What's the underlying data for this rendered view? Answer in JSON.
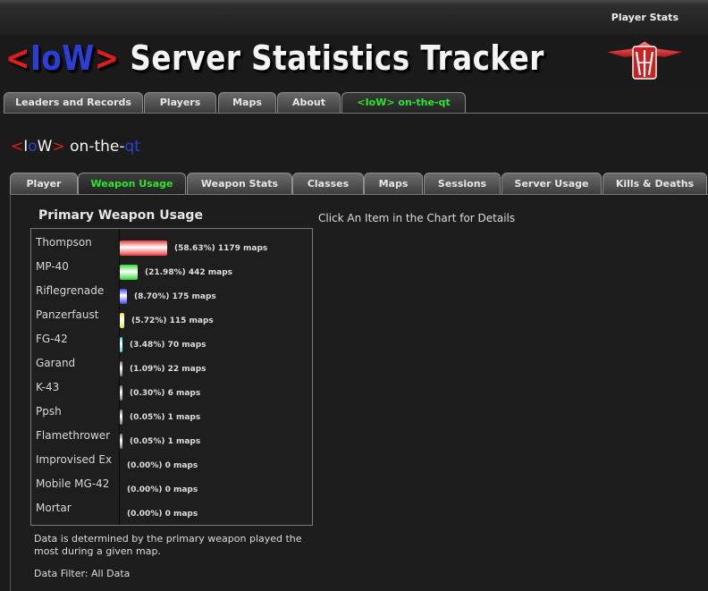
{
  "topbar": {
    "player_stats_link": "Player Stats"
  },
  "header": {
    "title_lt": "<",
    "title_i": "I",
    "title_o": "o",
    "title_w": "W",
    "title_gt": ">",
    "title_rest": " Server Statistics Tracker",
    "logo_icon": "wolfenstein-logo-icon"
  },
  "main_tabs": [
    {
      "label": "Leaders and Records"
    },
    {
      "label": "Players"
    },
    {
      "label": "Maps"
    },
    {
      "label": "About"
    },
    {
      "label": "<IoW> on-the-qt",
      "active": true
    }
  ],
  "server": {
    "lt": "<",
    "i": "I",
    "o": "o",
    "w": "W",
    "gt": ">",
    "mid": " on-the-",
    "qt": "qt"
  },
  "sub_tabs": [
    {
      "label": "Player"
    },
    {
      "label": "Weapon Usage",
      "active": true
    },
    {
      "label": "Weapon Stats"
    },
    {
      "label": "Classes"
    },
    {
      "label": "Maps"
    },
    {
      "label": "Sessions"
    },
    {
      "label": "Server Usage"
    },
    {
      "label": "Kills & Deaths"
    }
  ],
  "chart": {
    "title": "Primary Weapon Usage",
    "hint": "Click An Item in the Chart for Details",
    "note": "Data is determined by the primary weapon played the most during a given map.",
    "filter": "Data Filter: All Data"
  },
  "chart_data": {
    "type": "bar",
    "title": "Primary Weapon Usage",
    "categories": [
      "Thompson",
      "MP-40",
      "Riflegrenade",
      "Panzerfaust",
      "FG-42",
      "Garand",
      "K-43",
      "Ppsh",
      "Flamethrower",
      "Improvised Ex",
      "Mobile MG-42",
      "Mortar"
    ],
    "values": [
      1179,
      442,
      175,
      115,
      70,
      22,
      6,
      1,
      1,
      0,
      0,
      0
    ],
    "percents": [
      58.63,
      21.98,
      8.7,
      5.72,
      3.48,
      1.09,
      0.3,
      0.05,
      0.05,
      0.0,
      0.0,
      0.0
    ],
    "labels": [
      "(58.63%) 1179 maps",
      "(21.98%) 442 maps",
      "(8.70%) 175 maps",
      "(5.72%) 115 maps",
      "(3.48%) 70 maps",
      "(1.09%) 22 maps",
      "(0.30%) 6 maps",
      "(0.05%) 1 maps",
      "(0.05%) 1 maps",
      "(0.00%) 0 maps",
      "(0.00%) 0 maps",
      "(0.00%) 0 maps"
    ],
    "colors": [
      "#e83c3c",
      "#36d636",
      "#3a46e8",
      "#e8e63a",
      "#3ad6e8",
      "#777777",
      "#777777",
      "#777777",
      "#777777",
      "#777777",
      "#777777",
      "#777777"
    ]
  }
}
